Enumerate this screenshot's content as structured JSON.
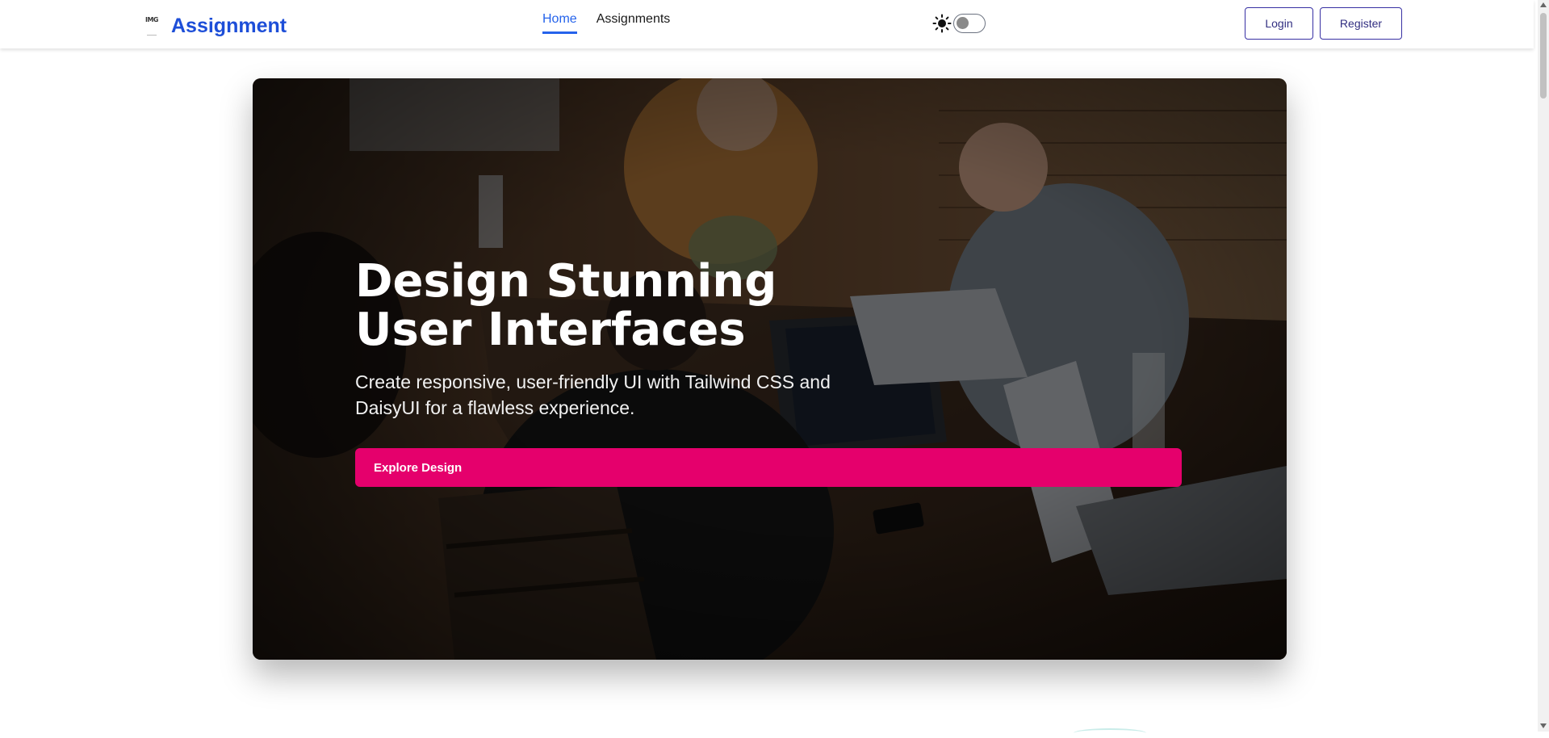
{
  "navbar": {
    "logo_placeholder": "IMG",
    "brand": "Assignment",
    "links": [
      {
        "label": "Home",
        "active": true
      },
      {
        "label": "Assignments",
        "active": false
      }
    ],
    "theme_toggle": {
      "icon": "sun-icon",
      "checked": false
    },
    "login_label": "Login",
    "register_label": "Register"
  },
  "hero": {
    "title": "Design Stunning User Interfaces",
    "subtitle": "Create responsive, user-friendly UI with Tailwind CSS and DaisyUI for a flawless experience.",
    "cta_label": "Explore Design"
  },
  "colors": {
    "brand": "#1d4ed8",
    "active_link": "#2563eb",
    "button_border": "#3730a3",
    "cta": "#e5006c"
  }
}
